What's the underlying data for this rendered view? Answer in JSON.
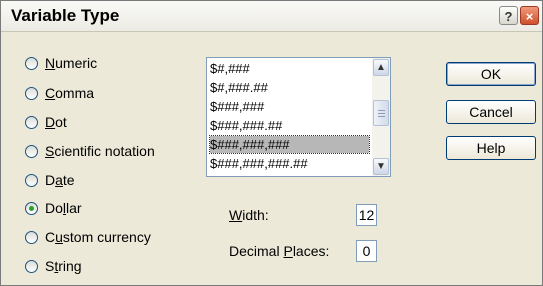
{
  "window": {
    "title": "Variable Type",
    "help_glyph": "?",
    "close_glyph": "×"
  },
  "types": [
    {
      "pre": "",
      "key": "N",
      "post": "umeric",
      "checked": false
    },
    {
      "pre": "",
      "key": "C",
      "post": "omma",
      "checked": false
    },
    {
      "pre": "",
      "key": "D",
      "post": "ot",
      "checked": false
    },
    {
      "pre": "",
      "key": "S",
      "post": "cientific notation",
      "checked": false
    },
    {
      "pre": "D",
      "key": "a",
      "post": "te",
      "checked": false
    },
    {
      "pre": "Do",
      "key": "l",
      "post": "lar",
      "checked": true
    },
    {
      "pre": "C",
      "key": "u",
      "post": "stom currency",
      "checked": false
    },
    {
      "pre": "S",
      "key": "t",
      "post": "ring",
      "checked": false
    }
  ],
  "formats": {
    "items": [
      "$#,###",
      "$#,###.##",
      "$###,###",
      "$###,###.##",
      "$###,###,###",
      "$###,###,###.##"
    ],
    "selected_index": 4
  },
  "width": {
    "pre": "",
    "key": "W",
    "post": "idth:",
    "value": "12"
  },
  "decimals": {
    "pre": "Decimal ",
    "key": "P",
    "post": "laces:",
    "value": "0"
  },
  "buttons": {
    "ok": "OK",
    "cancel": "Cancel",
    "help": "Help"
  },
  "icons": {
    "scroll_up": "▲",
    "scroll_down": "▼"
  }
}
